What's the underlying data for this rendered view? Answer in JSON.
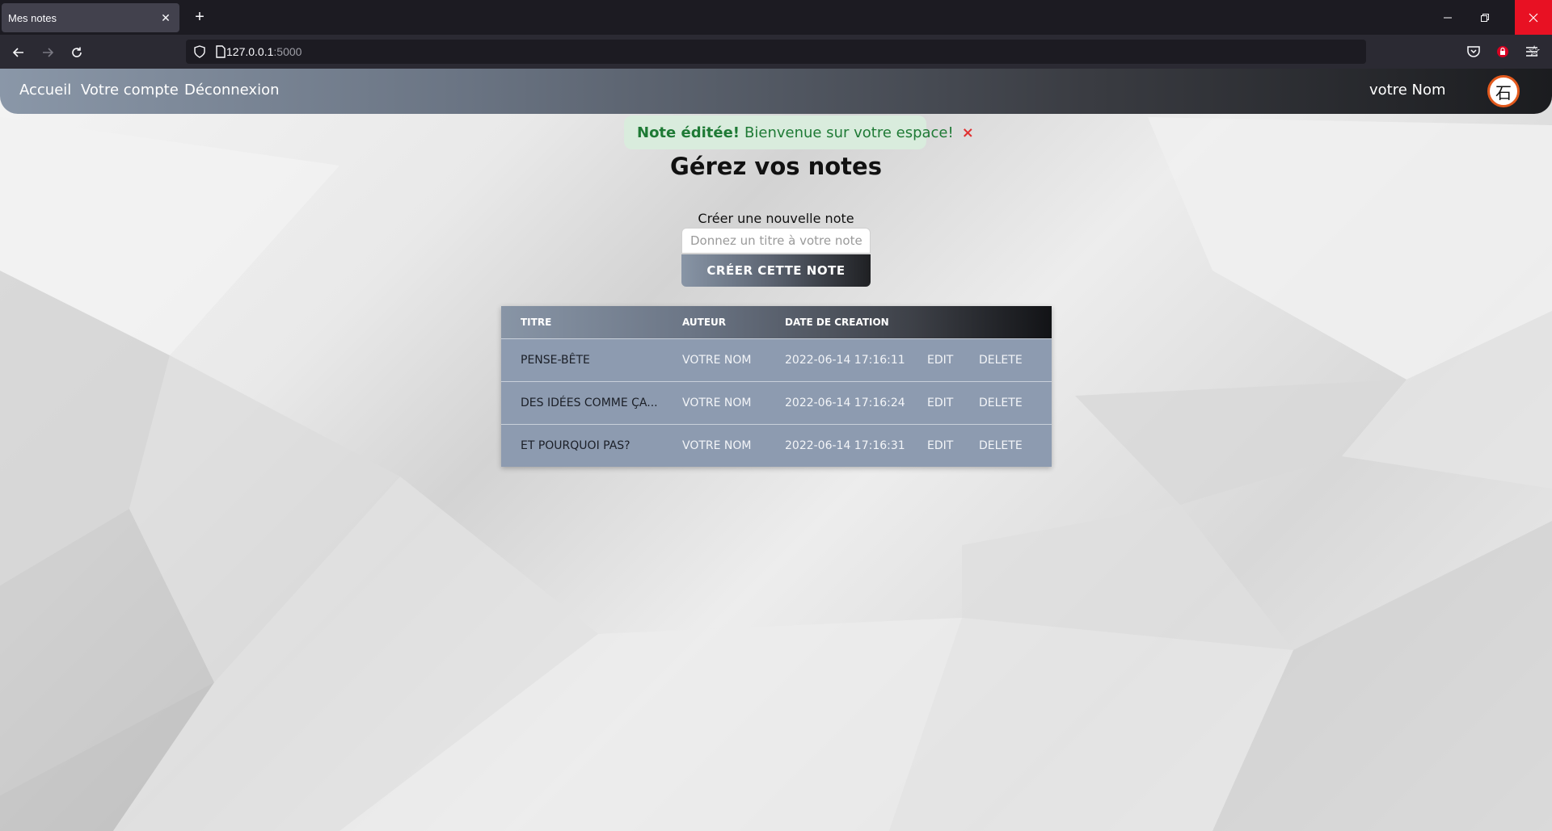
{
  "browser": {
    "tab_title": "Mes notes",
    "url_host": "127.0.0.1",
    "url_port": ":5000"
  },
  "nav": {
    "links": [
      "Accueil",
      "Votre compte",
      "Déconnexion"
    ],
    "username": "votre Nom",
    "avatar_glyph": "石"
  },
  "alert": {
    "strong": "Note éditée!",
    "message": "Bienvenue sur votre espace!",
    "close": "×"
  },
  "page": {
    "title": "Gérez vos notes"
  },
  "form": {
    "label": "Créer une nouvelle note",
    "placeholder": "Donnez un titre à votre note",
    "button": "CRÉER CETTE NOTE"
  },
  "table": {
    "headers": [
      "Titre",
      "Auteur",
      "Date de creation"
    ],
    "rows": [
      {
        "title": "Pense-bête",
        "author": "votre Nom",
        "date": "2022-06-14 17:16:11",
        "edit": "Edit",
        "delete": "Delete"
      },
      {
        "title": "Des idées comme ça...",
        "author": "votre Nom",
        "date": "2022-06-14 17:16:24",
        "edit": "Edit",
        "delete": "Delete"
      },
      {
        "title": "Et pourquoi pas?",
        "author": "votre Nom",
        "date": "2022-06-14 17:16:31",
        "edit": "Edit",
        "delete": "Delete"
      }
    ]
  },
  "colors": {
    "alert_green": "#1e7a35",
    "alert_bg": "#d9ecdd",
    "row_bg": "#8d9bb0",
    "close_red": "#e03131",
    "avatar_ring": "#e2591d"
  }
}
